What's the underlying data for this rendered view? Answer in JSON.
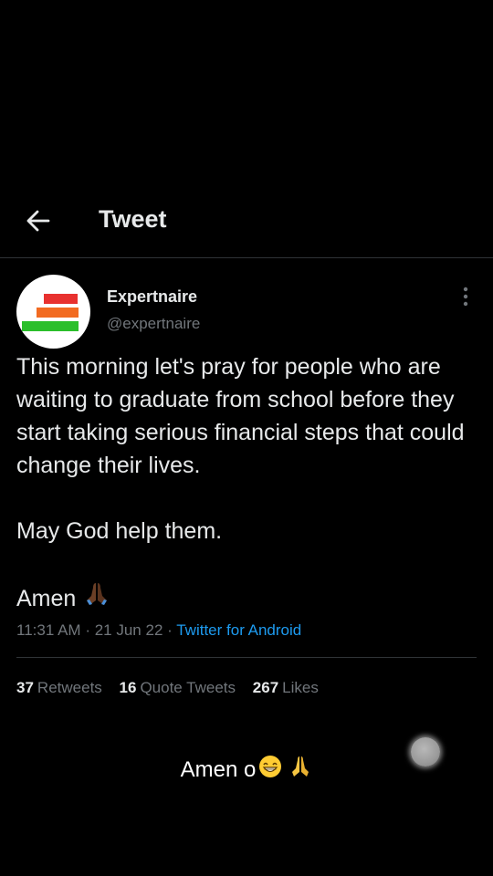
{
  "header": {
    "title": "Tweet",
    "back_icon": "arrow-left-icon"
  },
  "author": {
    "display_name": "Expertnaire",
    "handle": "@expertnaire",
    "avatar_colors": [
      "#e8312f",
      "#f26b21",
      "#2bbf2b"
    ]
  },
  "tweet": {
    "paragraph_1": "This morning let's pray for people who are waiting to graduate from school before they start taking serious financial steps that could change their lives.",
    "paragraph_2": "May God help them.",
    "paragraph_3": "Amen",
    "paragraph_3_emoji": "folded-hands-dark-skin-icon"
  },
  "meta": {
    "time": "11:31 AM",
    "date": "21 Jun 22",
    "separator": "·",
    "source": "Twitter for Android"
  },
  "stats": {
    "retweets_count": "37",
    "retweets_label": "Retweets",
    "quotes_count": "16",
    "quotes_label": "Quote Tweets",
    "likes_count": "267",
    "likes_label": "Likes"
  },
  "caption": {
    "text": "Amen o",
    "emojis": [
      "grinning-face-icon",
      "folded-hands-icon"
    ]
  },
  "colors": {
    "background": "#000000",
    "text_primary": "#e7e9ea",
    "text_secondary": "#71767b",
    "link": "#1d9bf0",
    "divider": "#2f3336"
  }
}
